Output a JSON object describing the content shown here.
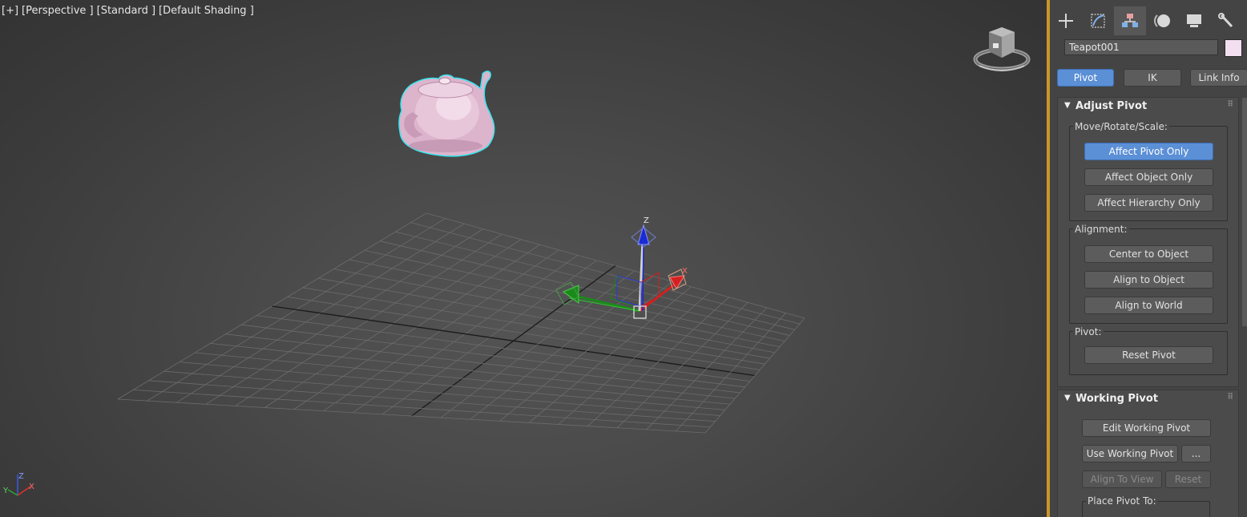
{
  "viewport": {
    "label": {
      "plus": "[+]",
      "view": "[Perspective ]",
      "style": "[Standard ]",
      "shading": "[Default Shading ]"
    },
    "gizmo_z_label": "Z",
    "gizmo_x_label": "X",
    "axis_labels": {
      "x": "X",
      "y": "Y",
      "z": "Z"
    },
    "colors": {
      "selection_outline": "#35e6f0",
      "teapot": "#e8bfd8",
      "x_axis": "#d42020",
      "y_axis": "#1a8a1a",
      "z_axis": "#1a2ad4"
    }
  },
  "command_panel": {
    "tabs": [
      {
        "icon": "create-plus-icon",
        "active": false
      },
      {
        "icon": "modify-icon",
        "active": false
      },
      {
        "icon": "hierarchy-icon",
        "active": true
      },
      {
        "icon": "motion-icon",
        "active": false
      },
      {
        "icon": "display-icon",
        "active": false
      },
      {
        "icon": "utilities-wrench-icon",
        "active": false
      }
    ],
    "object_name": "Teapot001",
    "object_color": "#f3dff0",
    "subtabs": {
      "pivot": "Pivot",
      "ik": "IK",
      "link_info": "Link Info"
    },
    "adjust_pivot": {
      "title": "Adjust Pivot",
      "move_group_label": "Move/Rotate/Scale:",
      "affect_pivot_only": "Affect Pivot Only",
      "affect_object_only": "Affect Object Only",
      "affect_hierarchy_only": "Affect Hierarchy Only",
      "alignment_label": "Alignment:",
      "center_to_object": "Center to Object",
      "align_to_object": "Align to Object",
      "align_to_world": "Align to World",
      "pivot_label": "Pivot:",
      "reset_pivot": "Reset Pivot"
    },
    "working_pivot": {
      "title": "Working Pivot",
      "edit_working_pivot": "Edit Working Pivot",
      "use_working_pivot": "Use Working Pivot",
      "more": "...",
      "align_to_view": "Align To View",
      "reset": "Reset",
      "place_pivot_to_label": "Place Pivot To:"
    }
  }
}
